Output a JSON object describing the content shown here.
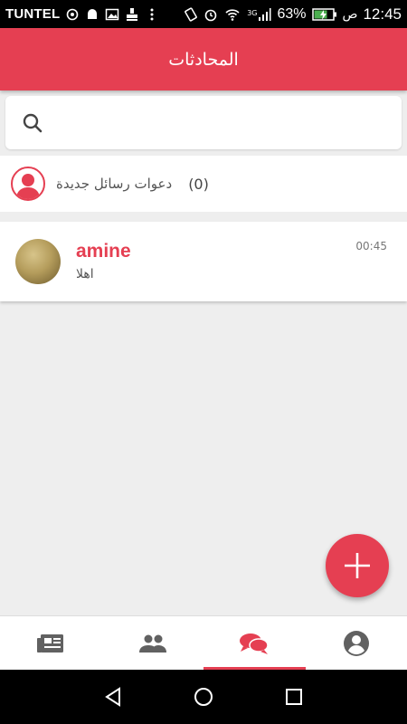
{
  "status_bar": {
    "carrier": "TUNTEL",
    "battery_percent": "63%",
    "am_pm": "ص",
    "time": "12:45",
    "network": "3G"
  },
  "app_bar": {
    "title": "المحادثات"
  },
  "search": {
    "placeholder": ""
  },
  "invitations": {
    "label": "دعوات رسائل جديدة",
    "count": "(0)"
  },
  "chats": [
    {
      "name": "amine",
      "last_message": "اهلا",
      "time": "00:45"
    }
  ],
  "bottom_nav": {
    "items": [
      {
        "icon": "news-icon",
        "active": false
      },
      {
        "icon": "people-icon",
        "active": false
      },
      {
        "icon": "chat-bubbles-icon",
        "active": true
      },
      {
        "icon": "account-icon",
        "active": false
      }
    ]
  },
  "colors": {
    "accent": "#e53f52",
    "background": "#eeeeee"
  }
}
